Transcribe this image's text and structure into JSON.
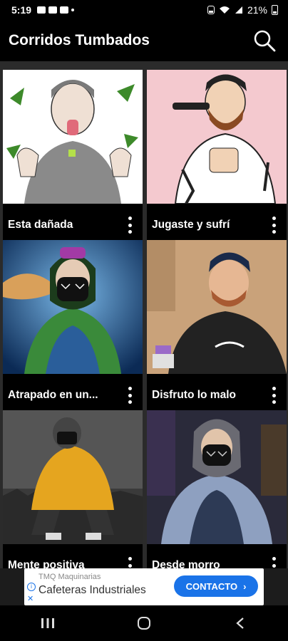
{
  "status": {
    "time": "5:19",
    "battery": "21%",
    "icons": [
      "gallery-icon",
      "youtube-icon",
      "youtube-icon",
      "dot-icon",
      "alarm-icon",
      "wifi-icon",
      "signal-icon",
      "battery-icon"
    ]
  },
  "appbar": {
    "title": "Corridos Tumbados",
    "search_icon": "search-icon"
  },
  "songs": [
    {
      "title": "Esta dañada",
      "bg": "#ffffff",
      "accent": "#8a8a8a"
    },
    {
      "title": "Jugaste y sufrí",
      "bg": "#f4c9cf",
      "accent": "#ffffff"
    },
    {
      "title": "Atrapado en un...",
      "bg": "#1f5fa8",
      "accent": "#3a8a3a"
    },
    {
      "title": "Disfruto lo malo",
      "bg": "#c9a27a",
      "accent": "#222222"
    },
    {
      "title": "Mente positiva",
      "bg": "#555555",
      "accent": "#e5a51f"
    },
    {
      "title": "Desde morro",
      "bg": "#2a2a3a",
      "accent": "#8ea0c0"
    }
  ],
  "ad": {
    "advertiser": "TMQ Maquinarias",
    "headline": "Cafeteras Industriales",
    "cta": "CONTACTO",
    "cta_color": "#1a73e8"
  },
  "nav": {
    "recents": "recents-icon",
    "home": "home-icon",
    "back": "back-icon"
  }
}
